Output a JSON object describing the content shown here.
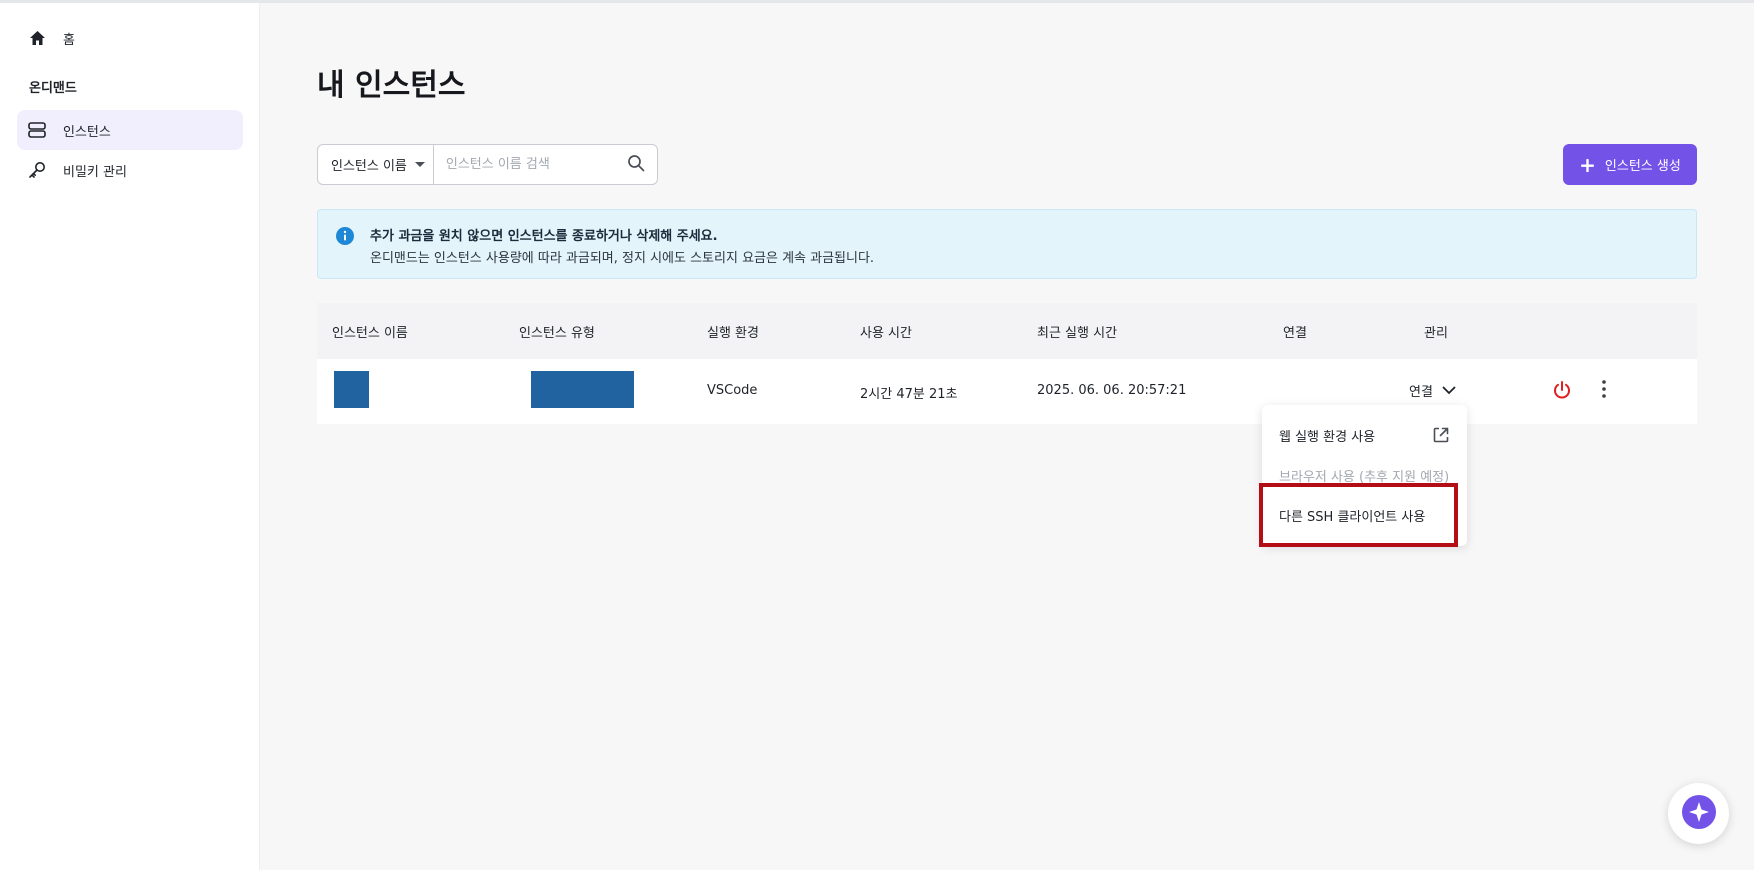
{
  "sidebar": {
    "home_label": "홈",
    "section_title": "온디맨드",
    "items": [
      {
        "label": "인스턴스",
        "icon": "server-icon",
        "active": true
      },
      {
        "label": "비밀키 관리",
        "icon": "key-icon",
        "active": false
      }
    ]
  },
  "main": {
    "title": "내 인스턴스",
    "search": {
      "filter_label": "인스턴스 이름",
      "placeholder": "인스턴스 이름 검색",
      "value": ""
    },
    "create_button": "인스턴스 생성",
    "alert": {
      "title": "추가 과금을 원치 않으면 인스턴스를 종료하거나 삭제해 주세요.",
      "message": "온디맨드는 인스턴스 사용량에 따라 과금되며, 정지 시에도 스토리지 요금은 계속 과금됩니다."
    },
    "table": {
      "columns": [
        "인스턴스 이름",
        "인스턴스 유형",
        "실행 환경",
        "사용 시간",
        "최근 실행 시간",
        "연결",
        "관리"
      ],
      "rows": [
        {
          "name": "",
          "type": "",
          "environment": "VSCode",
          "usage_time": "2시간 47분 21초",
          "last_run": "2025. 06. 06. 20:57:21",
          "connect_label": "연결"
        }
      ]
    },
    "connect_menu": [
      {
        "label": "웹 실행 환경 사용",
        "disabled": false
      },
      {
        "label": "브라우저 사용 (추후 지원 예정)",
        "disabled": true
      },
      {
        "label": "다른 SSH 클라이언트 사용",
        "disabled": false,
        "highlighted": true
      }
    ]
  },
  "colors": {
    "accent": "#7352e8",
    "alert_bg": "#e3f4fb",
    "power_red": "#e02020",
    "highlight_red": "#b30d15",
    "redaction_blue": "#2162a1"
  }
}
